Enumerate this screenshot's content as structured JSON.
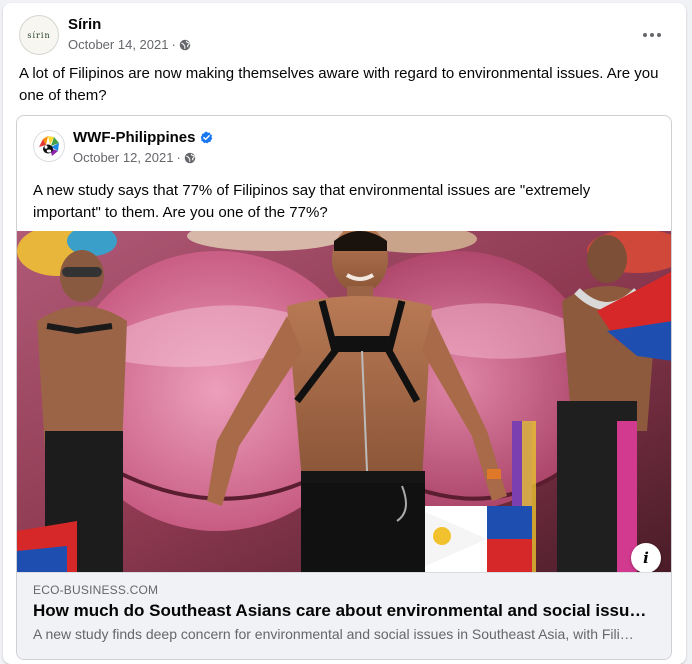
{
  "post": {
    "author": "Sírin",
    "avatar_text": "sírin",
    "date": "October 14, 2021",
    "separator": "·",
    "audience_icon": "globe-icon",
    "text": "A lot of Filipinos are now making themselves aware with regard to environmental issues. Are you one of them?"
  },
  "shared_post": {
    "page_name": "WWF-Philippines",
    "verified_icon": "verified-badge-icon",
    "date": "October 12, 2021",
    "separator": "·",
    "audience_icon": "globe-icon",
    "text": "A new study says that 77% of Filipinos say that environmental issues are \"extremely important\" to them. Are you one of the 77%?"
  },
  "link_preview": {
    "image_description": "photo-parade-dancers",
    "info_glyph": "i",
    "domain": "ECO-BUSINESS.COM",
    "title": "How much do Southeast Asians care about environmental and social issues?",
    "description": "A new study finds deep concern for environmental and social issues in Southeast Asia, with Filipinos most worried about them."
  },
  "colors": {
    "link_bg": "#f0f2f5",
    "secondary_text": "#65676b",
    "verified_blue": "#1877f2"
  }
}
